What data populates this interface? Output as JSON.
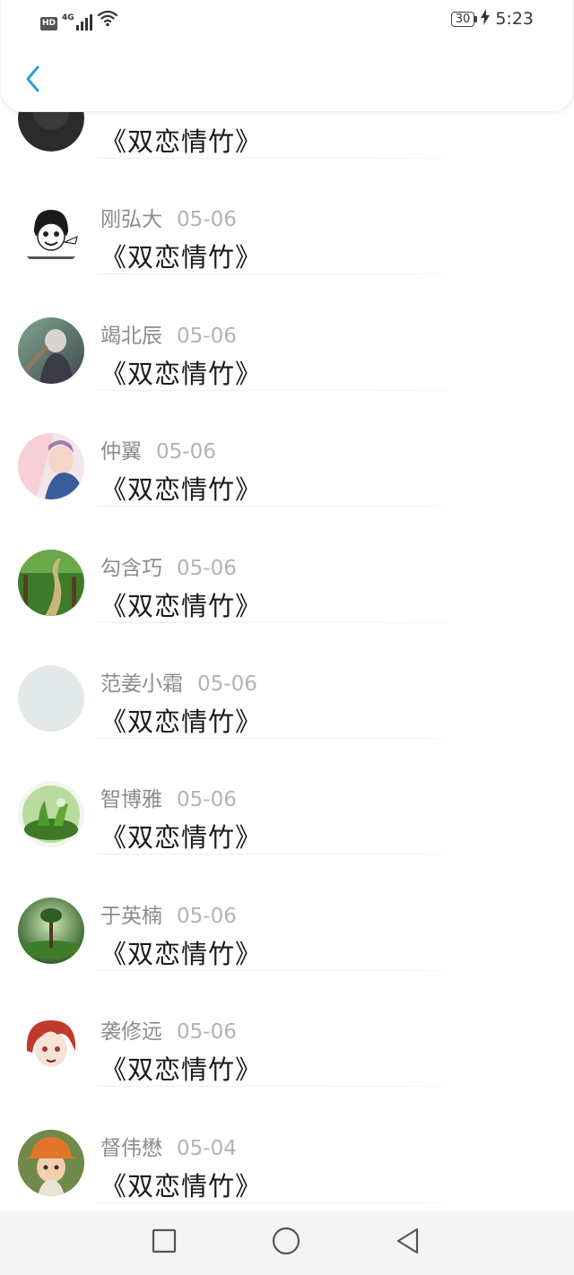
{
  "status_bar": {
    "hd": "HD",
    "network": "4G",
    "battery": "30",
    "time": "5:23"
  },
  "nav": {
    "back_icon": "chevron-left-icon",
    "accent_color": "#2a9fd8"
  },
  "items": [
    {
      "name": "",
      "date": "",
      "message": "《双恋情竹》",
      "avatar": "dark-circle"
    },
    {
      "name": "刚弘大",
      "date": "05-06",
      "message": "《双恋情竹》",
      "avatar": "meme-face"
    },
    {
      "name": "竭北辰",
      "date": "05-06",
      "message": "《双恋情竹》",
      "avatar": "anime-grey"
    },
    {
      "name": "仲翼",
      "date": "05-06",
      "message": "《双恋情竹》",
      "avatar": "anime-pink"
    },
    {
      "name": "勾含巧",
      "date": "05-06",
      "message": "《双恋情竹》",
      "avatar": "garden-path"
    },
    {
      "name": "范姜小霜",
      "date": "05-06",
      "message": "《双恋情竹》",
      "avatar": "blank-gray"
    },
    {
      "name": "智博雅",
      "date": "05-06",
      "message": "《双恋情竹》",
      "avatar": "terrarium"
    },
    {
      "name": "于英楠",
      "date": "05-06",
      "message": "《双恋情竹》",
      "avatar": "green-tree"
    },
    {
      "name": "袭修远",
      "date": "05-06",
      "message": "《双恋情竹》",
      "avatar": "anime-redhair"
    },
    {
      "name": "督伟懋",
      "date": "05-04",
      "message": "《双恋情竹》",
      "avatar": "child-orange-hat"
    }
  ],
  "nav_bar": {
    "recent_icon": "square-icon",
    "home_icon": "circle-icon",
    "back_icon": "triangle-back-icon"
  }
}
